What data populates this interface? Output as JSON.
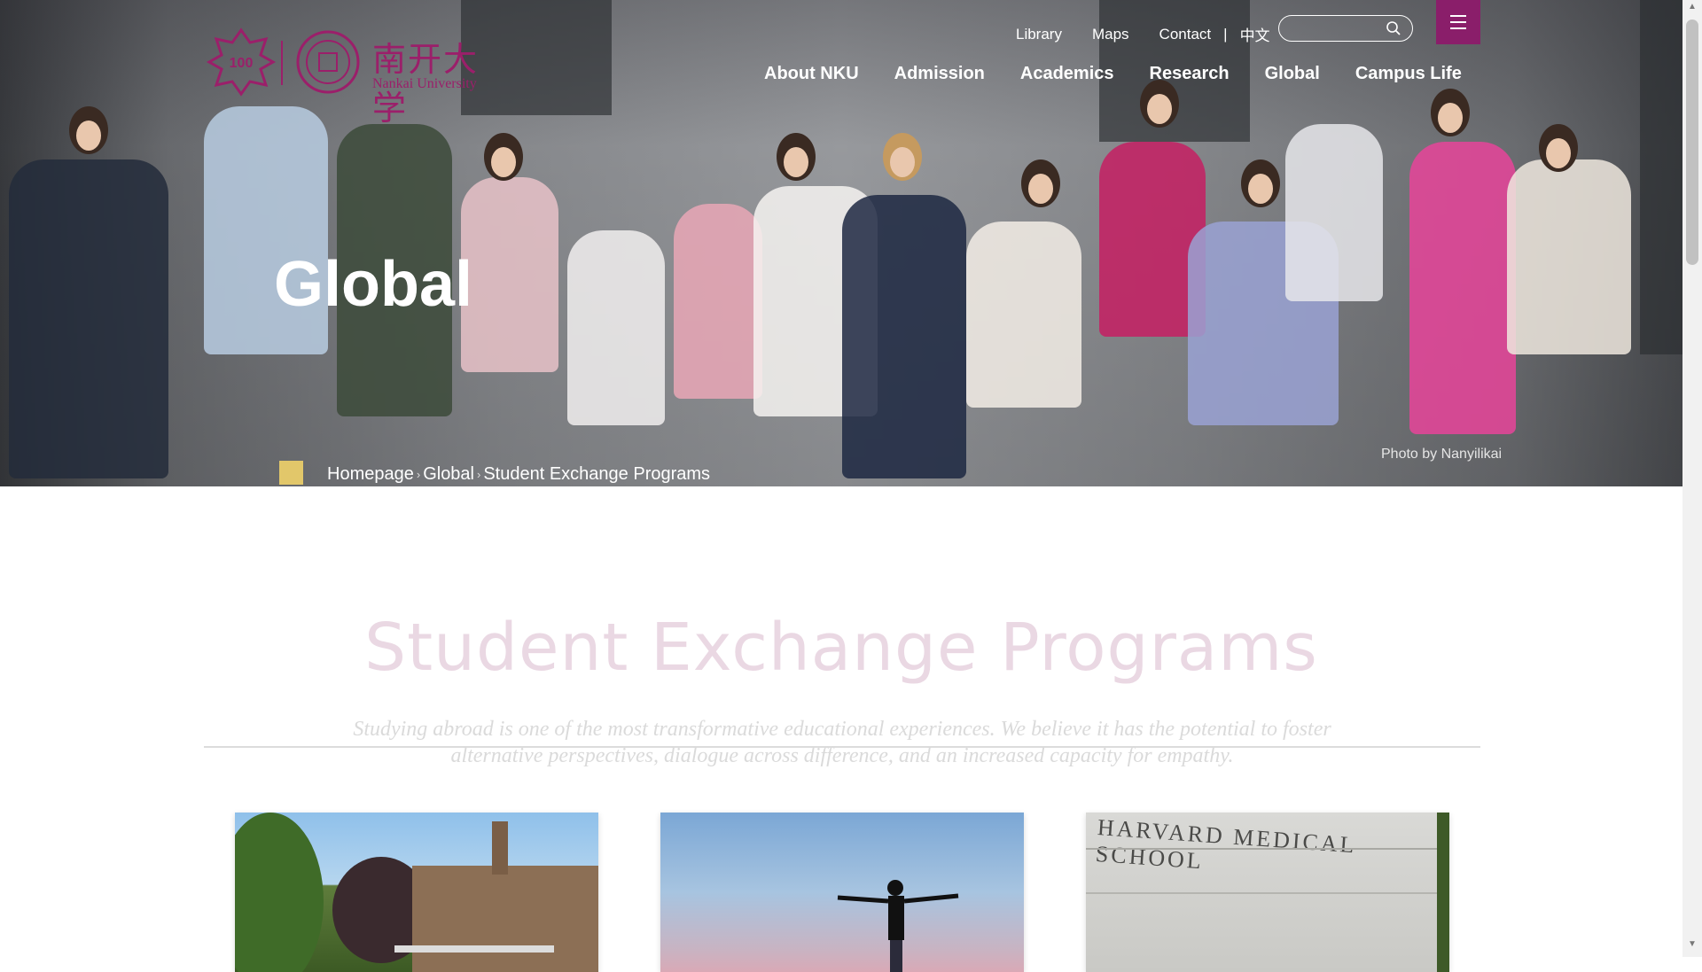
{
  "brand": {
    "name_cn": "南开大学",
    "name_en": "Nankai University",
    "centennial_badge": "100"
  },
  "topnav": {
    "links": [
      "Library",
      "Maps",
      "Contact"
    ],
    "language": "中文"
  },
  "search": {
    "placeholder": "",
    "value": ""
  },
  "mainnav": [
    "About NKU",
    "Admission",
    "Academics",
    "Research",
    "Global",
    "Campus Life"
  ],
  "hero": {
    "title": "Global",
    "photo_credit": "Photo by Nanyilikai"
  },
  "breadcrumb": {
    "items": [
      "Homepage",
      "Global",
      "Student Exchange Programs"
    ]
  },
  "content": {
    "title": "Student Exchange Programs",
    "intro": "Studying abroad is one of the most transformative educational experiences. We believe it has the potential to foster alternative perspectives, dialogue across difference, and an increased capacity for empathy."
  },
  "cards": [
    {
      "name": "college-building-image"
    },
    {
      "name": "person-sky-image"
    },
    {
      "name": "harvard-medical-image",
      "sign_text": "HARVARD MEDICAL SCHOOL"
    }
  ],
  "colors": {
    "accent": "#8a1e6a",
    "crumb_square": "#e2c76a",
    "title_faded": "#ead8e3"
  },
  "icons": {
    "search": "search-icon",
    "menu": "menu-icon",
    "chevron": "chevron-right-icon"
  }
}
